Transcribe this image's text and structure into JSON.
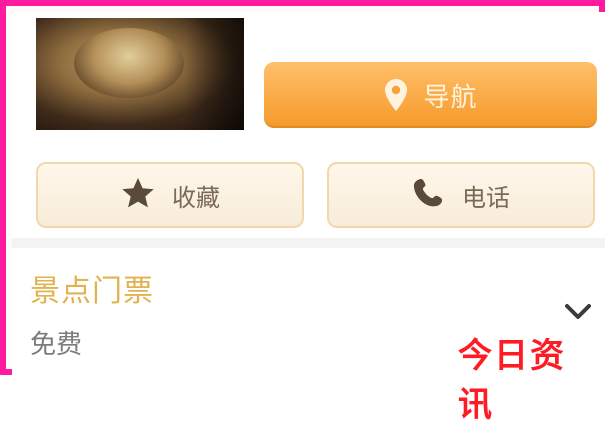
{
  "actions": {
    "navigate_label": "导航",
    "favorite_label": "收藏",
    "call_label": "电话"
  },
  "section": {
    "title": "景点门票",
    "subtitle": "免费"
  },
  "watermark": {
    "text": "今日资讯"
  },
  "icons": {
    "navigate": "map-pin-icon",
    "favorite": "star-icon",
    "call": "phone-icon",
    "expand": "chevron-down-icon"
  },
  "colors": {
    "border": "#ff1aa0",
    "primary_button": "#f59a2a",
    "section_title": "#e1b24f",
    "watermark": "#ff1b24"
  }
}
